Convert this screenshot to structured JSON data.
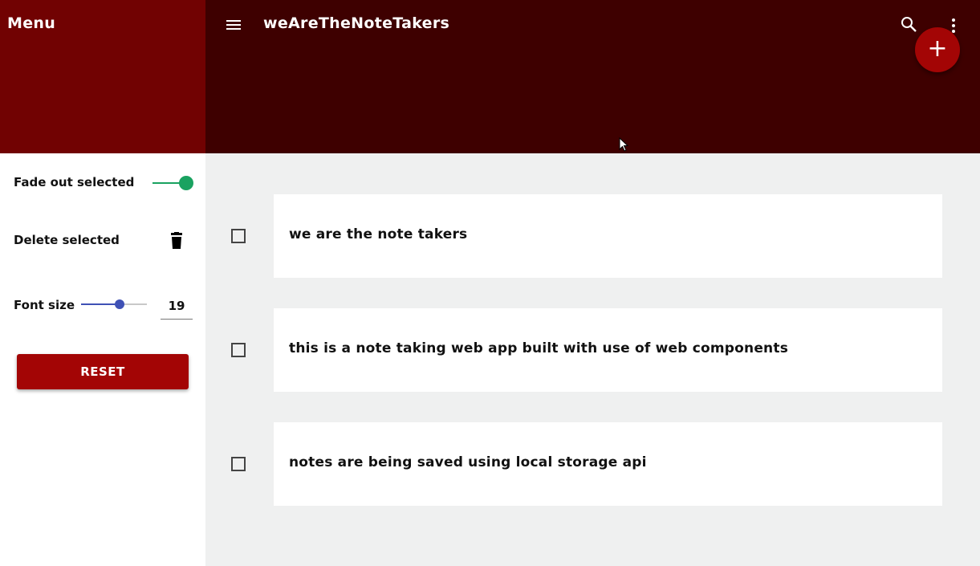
{
  "drawer": {
    "title": "Menu",
    "fade_label": "Fade out selected",
    "fade_enabled": true,
    "delete_label": "Delete selected",
    "font_size_label": "Font size",
    "font_size_value": "19",
    "reset_label": "RESET"
  },
  "appbar": {
    "title": "weAreTheNoteTakers",
    "fab_symbol": "+"
  },
  "notes": [
    {
      "text": "we are the note takers",
      "checked": false
    },
    {
      "text": "this is a note taking web app built with use of web components",
      "checked": false
    },
    {
      "text": "notes are being saved using local storage api",
      "checked": false
    }
  ],
  "colors": {
    "drawer_header": "#710202",
    "appbar": "#3e0000",
    "accent": "#a30505",
    "toggle": "#1aa260",
    "slider": "#3f51b5",
    "background": "#eff0f0"
  },
  "icons": [
    "menu-icon",
    "search-icon",
    "more-vert-icon",
    "add-icon",
    "trash-icon"
  ]
}
